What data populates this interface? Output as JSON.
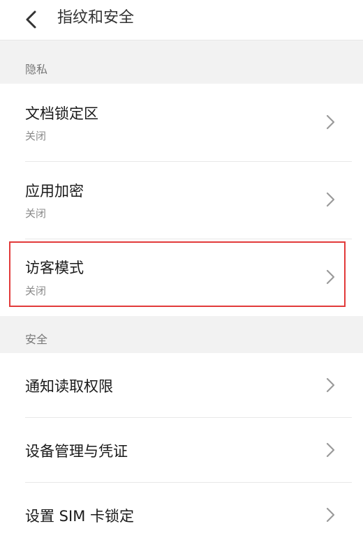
{
  "header": {
    "title": "指纹和安全",
    "back_icon": "chevron-left-icon"
  },
  "sections": [
    {
      "title": "隐私",
      "items": [
        {
          "title": "文档锁定区",
          "subtitle": "关闭"
        },
        {
          "title": "应用加密",
          "subtitle": "关闭"
        },
        {
          "title": "访客模式",
          "subtitle": "关闭",
          "highlighted": true
        }
      ]
    },
    {
      "title": "安全",
      "items": [
        {
          "title": "通知读取权限"
        },
        {
          "title": "设备管理与凭证"
        },
        {
          "title": "设置 SIM 卡锁定"
        }
      ]
    }
  ],
  "colors": {
    "highlight": "#e23a3a",
    "section_bg": "#f2f2f2"
  }
}
